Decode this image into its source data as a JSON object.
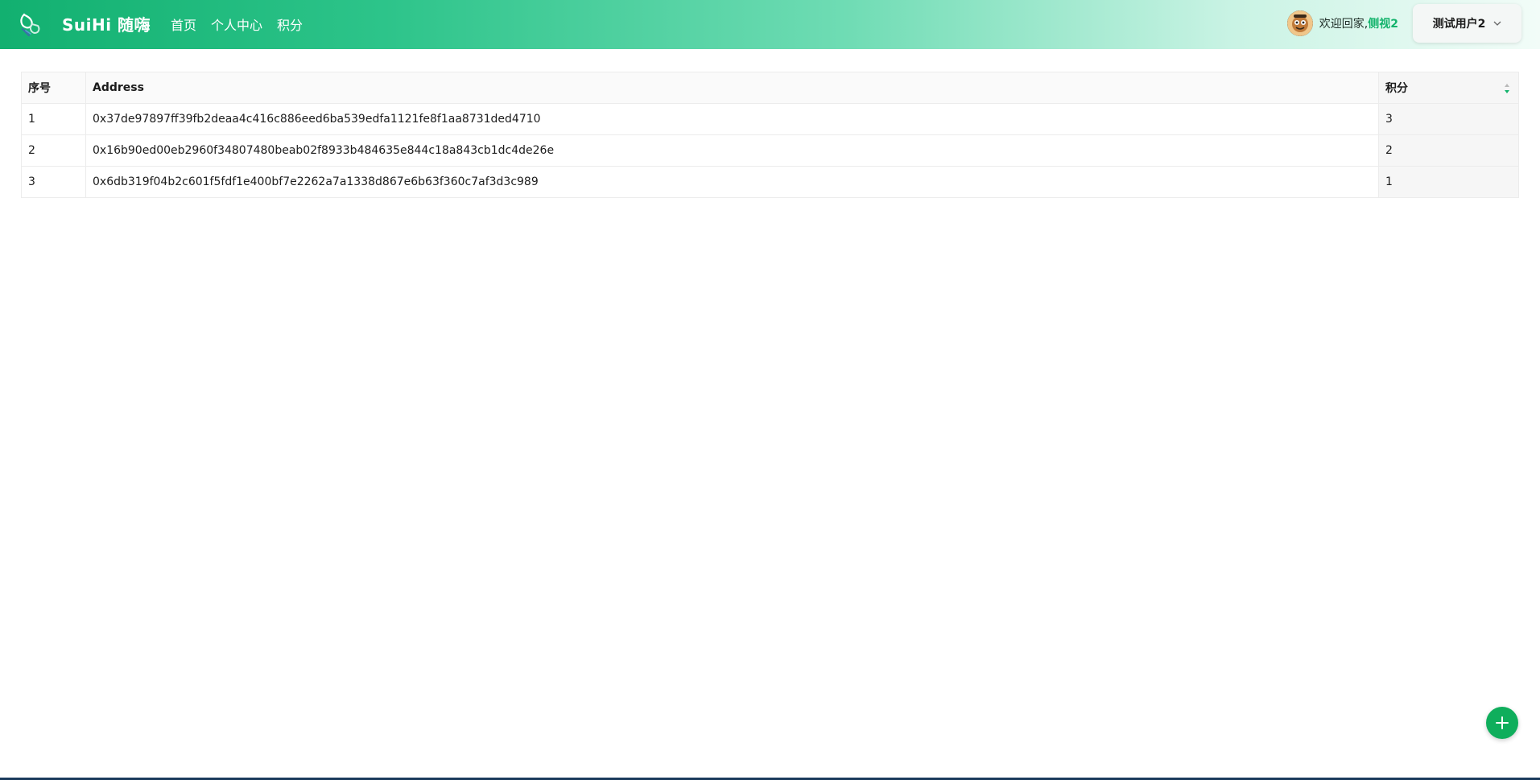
{
  "header": {
    "brand": "SuiHi 随嗨",
    "nav": [
      "首页",
      "个人中心",
      "积分"
    ],
    "welcome_prefix": "欢迎回家,",
    "welcome_name": "侧视2",
    "account_label": "测试用户2"
  },
  "table": {
    "columns": [
      "序号",
      "Address",
      "积分"
    ],
    "rows": [
      {
        "idx": "1",
        "address": "0x37de97897ff39fb2deaa4c416c886eed6ba539edfa1121fe8f1aa8731ded4710",
        "score": "3"
      },
      {
        "idx": "2",
        "address": "0x16b90ed00eb2960f34807480beab02f8933b484635e844c18a843cb1dc4de26e",
        "score": "2"
      },
      {
        "idx": "3",
        "address": "0x6db319f04b2c601f5fdf1e400bf7e2262a7a1338d867e6b63f360c7af3d3c989",
        "score": "1"
      }
    ]
  },
  "colors": {
    "accent": "#13b36c",
    "fab": "#0fae5c"
  },
  "icons": {
    "logo": "suihi-logo-icon",
    "sort": "sort-arrows-icon",
    "chevron": "chevron-down-icon",
    "add": "plus-icon"
  }
}
